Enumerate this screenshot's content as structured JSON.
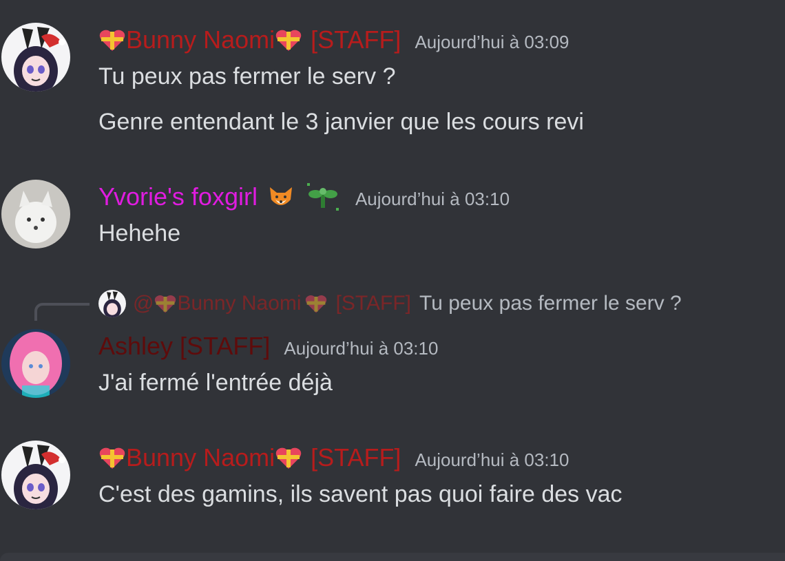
{
  "messages": [
    {
      "username": "Bunny Naomi",
      "tag": "[STAFF]",
      "timestamp": "Aujourd’hui à 03:09",
      "lines": [
        "Tu peux pas fermer le serv ?",
        "Genre entendant le 3 janvier que les cours revi"
      ]
    },
    {
      "username": "Yvorie's foxgirl",
      "timestamp": "Aujourd’hui à 03:10",
      "lines": [
        "Hehehe"
      ]
    },
    {
      "reply": {
        "mention": "@",
        "username": "Bunny Naomi",
        "tag": "[STAFF]",
        "text": "Tu peux pas fermer le serv ?"
      },
      "username": "Ashley [STAFF]",
      "timestamp": "Aujourd’hui à 03:10",
      "lines": [
        "J'ai fermé l'entrée déjà"
      ]
    },
    {
      "username": "Bunny Naomi",
      "tag": "[STAFF]",
      "timestamp": "Aujourd’hui à 03:10",
      "lines": [
        "C'est des gamins,  ils savent pas quoi faire des vac"
      ]
    }
  ],
  "icons": {
    "heart_gift": "heart-gift-emoji",
    "fox": "fox-face-emoji",
    "sprout": "sprout-sparkle-emoji"
  },
  "colors": {
    "background": "#313338",
    "staff_red": "#b71c1c",
    "foxgirl_pink": "#e01ce0",
    "ashley_darkred": "#5e0b0b",
    "timestamp": "#b5bac1",
    "text": "#dbdee1"
  }
}
